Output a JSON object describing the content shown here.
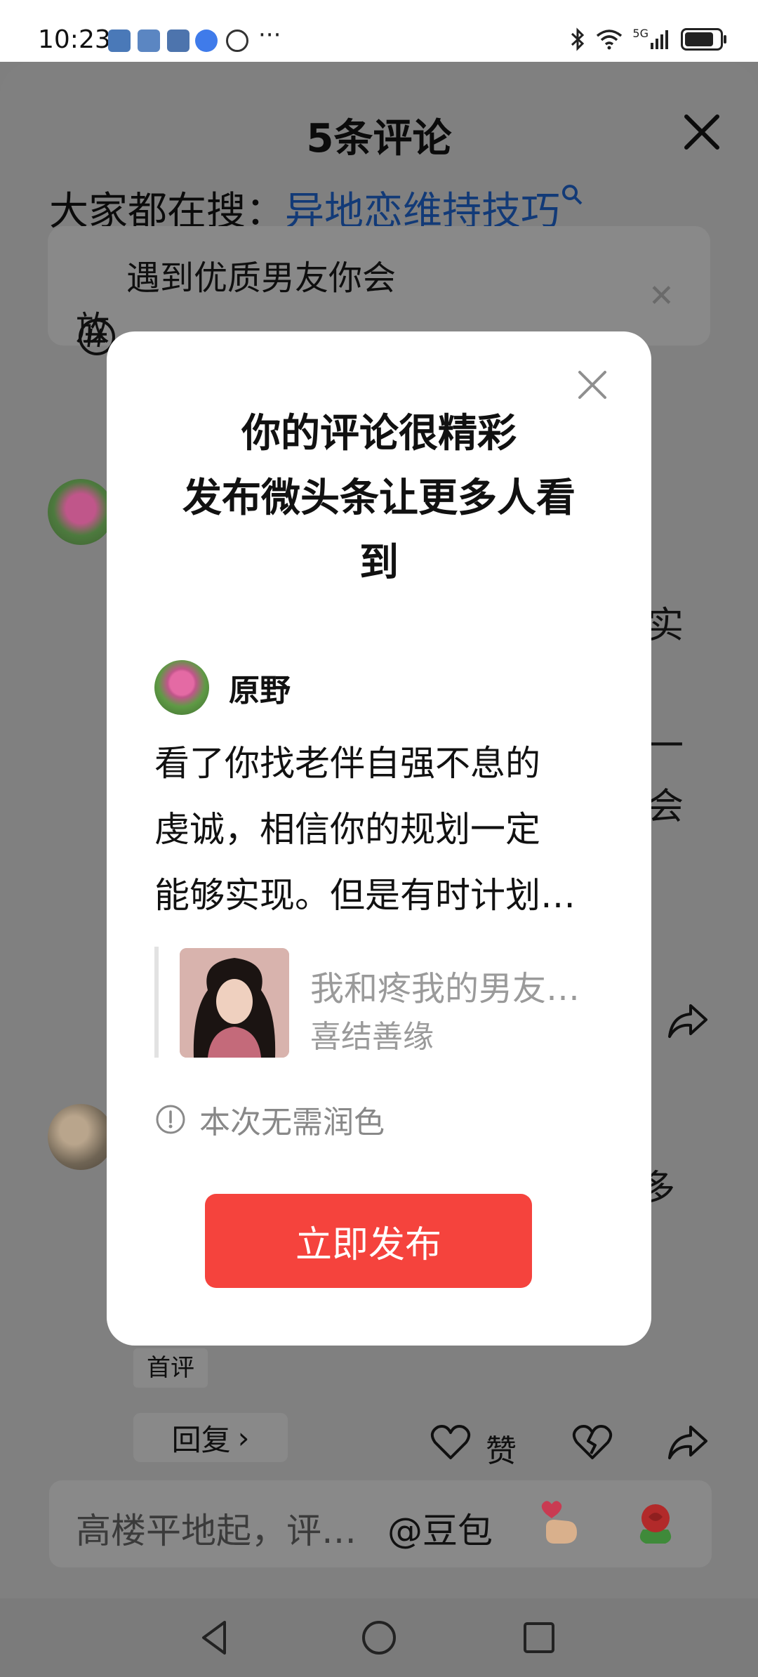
{
  "status_bar": {
    "time": "10:23",
    "dots": "···",
    "network": "5G",
    "battery_level": 0.9
  },
  "sheet": {
    "title": "5条评论",
    "search_prefix": "大家都在搜：",
    "search_link": "异地恋维持技巧",
    "topic_text_line1": "遇到优质男友你会",
    "topic_text_line2": "放",
    "bg_chars": [
      "实",
      "一",
      "会",
      "多"
    ],
    "first_comment_tag": "首评",
    "reply_label": "回复",
    "like_label": "赞"
  },
  "input_bar": {
    "placeholder": "高楼平地起，评…",
    "mention": "@豆包"
  },
  "modal": {
    "title_line1": "你的评论很精彩",
    "title_line2": "发布微头条让更多人看",
    "title_line3": "到",
    "author_name": "原野",
    "comment_line1": "看了你找老伴自强不息的",
    "comment_line2": "虔诚，相信你的规划一定",
    "comment_line3": "能够实现。但是有时计划…",
    "quote_title": "我和疼我的男友…",
    "quote_author": "喜结善缘",
    "hint": "本次无需润色",
    "publish_button": "立即发布"
  },
  "colors": {
    "publish_red": "#f5433d",
    "link_blue": "#123a77",
    "overlay_gray": "#808080"
  }
}
